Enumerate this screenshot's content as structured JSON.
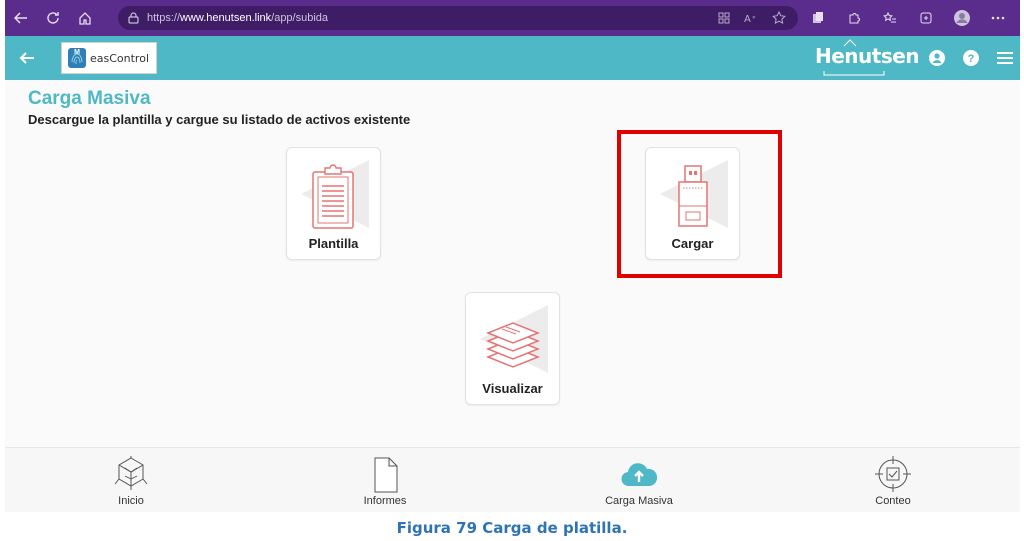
{
  "browser": {
    "url_prefix": "https://",
    "url_domain": "www.henutsen.link",
    "url_path": "/app/subida"
  },
  "header": {
    "logo_text": "easControl",
    "brand": "Henutsen"
  },
  "page": {
    "title": "Carga Masiva",
    "subtitle": "Descargue la plantilla y cargue su listado de activos existente"
  },
  "cards": {
    "plantilla": "Plantilla",
    "cargar": "Cargar",
    "visualizar": "Visualizar"
  },
  "nav": {
    "inicio": "Inicio",
    "informes": "Informes",
    "carga_masiva": "Carga Masiva",
    "conteo": "Conteo"
  },
  "caption": "Figura 79 Carga de platilla.",
  "colors": {
    "accent": "#4fb8c6",
    "browser": "#5a2d8c",
    "icon_red": "#e57373",
    "highlight": "#e00000",
    "caption": "#2e74b5"
  }
}
